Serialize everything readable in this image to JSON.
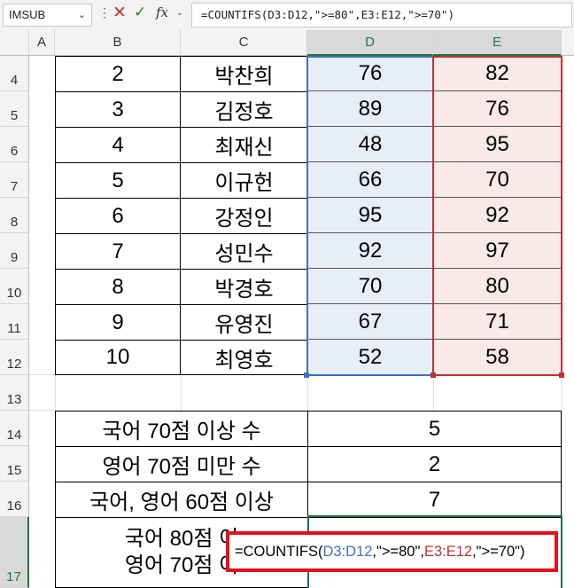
{
  "formula_bar": {
    "name_box": "IMSUB",
    "name_caret": "⌄",
    "more": "⋮",
    "cancel": "✕",
    "enter": "✓",
    "fx": "fx",
    "fx_caret": "⌄",
    "formula": "=COUNTIFS(D3:D12,\">=80\",E3:E12,\">=70\")"
  },
  "columns": [
    "A",
    "B",
    "C",
    "D",
    "E"
  ],
  "rows": [
    "4",
    "5",
    "6",
    "7",
    "8",
    "9",
    "10",
    "11",
    "12",
    "13",
    "14",
    "15",
    "16",
    "17"
  ],
  "data_rows": [
    {
      "num": "2",
      "name": "박찬희",
      "d": "76",
      "e": "82"
    },
    {
      "num": "3",
      "name": "김정호",
      "d": "89",
      "e": "76"
    },
    {
      "num": "4",
      "name": "최재신",
      "d": "48",
      "e": "95"
    },
    {
      "num": "5",
      "name": "이규헌",
      "d": "66",
      "e": "70"
    },
    {
      "num": "6",
      "name": "강정인",
      "d": "95",
      "e": "92"
    },
    {
      "num": "7",
      "name": "성민수",
      "d": "92",
      "e": "97"
    },
    {
      "num": "8",
      "name": "박경호",
      "d": "70",
      "e": "80"
    },
    {
      "num": "9",
      "name": "유영진",
      "d": "67",
      "e": "71"
    },
    {
      "num": "10",
      "name": "최영호",
      "d": "52",
      "e": "58"
    }
  ],
  "summary": [
    {
      "label": "국어 70점 이상 수",
      "value": "5"
    },
    {
      "label": "영어 70점 미만 수",
      "value": "2"
    },
    {
      "label": "국어, 영어 60점 이상",
      "value": "7"
    }
  ],
  "row17": {
    "line1": "국어 80점 이",
    "line2": "영어 70점 이"
  },
  "editing": {
    "pre": "=COUNTIFS(",
    "ref1": "D3:D12",
    "mid": ",\">=80\",",
    "ref2": "E3:E12",
    "post": ",\">=70\")"
  },
  "colors": {
    "ref1": "#3e70c4",
    "ref2": "#c0322f",
    "highlight": "#e3101c",
    "selection": "#217346"
  }
}
